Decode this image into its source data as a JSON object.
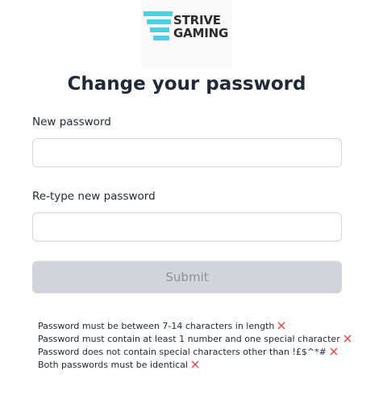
{
  "logo": {
    "line1": "STRIVE",
    "line2": "GAMING",
    "icon": "stacked-bars-logo-icon",
    "accent_color": "#4dd0e1"
  },
  "title": "Change your password",
  "form": {
    "new_password": {
      "label": "New password",
      "value": "",
      "placeholder": ""
    },
    "retype_password": {
      "label": "Re-type new password",
      "value": "",
      "placeholder": ""
    },
    "submit_label": "Submit",
    "submit_enabled": false
  },
  "rules": [
    {
      "text": "Password must be between 7-14 characters in length",
      "status": "fail",
      "icon": "close-icon"
    },
    {
      "text": "Password must contain at least 1 number and one special character",
      "status": "fail",
      "icon": "close-icon"
    },
    {
      "text": "Password does not contain special characters other than !£$^*#",
      "status": "fail",
      "icon": "close-icon"
    },
    {
      "text": "Both passwords must be identical",
      "status": "fail",
      "icon": "close-icon"
    }
  ],
  "colors": {
    "fail": "#e53e3e",
    "submit_disabled_bg": "#d1d5db",
    "submit_disabled_text": "#8b929c"
  }
}
